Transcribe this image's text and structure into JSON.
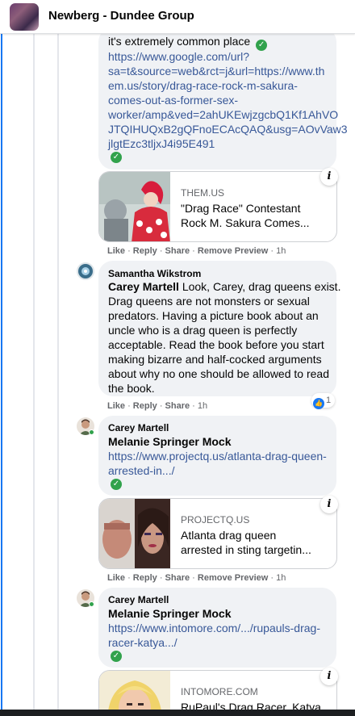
{
  "header": {
    "group_name": "Newberg - Dundee Group"
  },
  "comment1": {
    "text_tail": "it's extremely common place",
    "link_lines": [
      "https://www.google.com/url?",
      "sa=t&source=web&rct=j&url=https://www.th",
      "em.us/story/drag-race-rock-m-sakura-",
      "comes-out-as-former-sex-",
      "worker/amp&ved=2ahUKEwjzgcbQ1Kf1AhVO",
      "JTQIHUQxB2gQFnoECAcQAQ&usg=AOvVaw3",
      "jlgtEzc3tljxJ4i95E491"
    ],
    "card": {
      "domain": "THEM.US",
      "title_lines": [
        "\"Drag Race\" Contestant",
        "Rock M. Sakura Comes..."
      ]
    },
    "actions": {
      "like": "Like",
      "reply": "Reply",
      "share": "Share",
      "remove": "Remove Preview",
      "time": "1h"
    }
  },
  "comment2": {
    "author": "Samantha Wikstrom",
    "mention": "Carey Martell",
    "text_lines": [
      " Look, Carey, drag queens exist.",
      "Drag queens are not monsters or sexual",
      "predators. Having a picture book about an",
      "uncle who is a drag queen is perfectly",
      "acceptable. Read the book before you start",
      "making bizarre and half-cocked arguments",
      "about why no one should be allowed to read",
      "the book."
    ],
    "reaction_count": "1",
    "actions": {
      "like": "Like",
      "reply": "Reply",
      "share": "Share",
      "time": "1h"
    }
  },
  "comment3": {
    "author": "Carey Martell",
    "mention": "Melanie Springer Mock",
    "link_lines": [
      "https://www.projectq.us/atlanta-drag-queen-",
      "arrested-in.../"
    ],
    "card": {
      "domain": "PROJECTQ.US",
      "title_lines": [
        "Atlanta drag queen",
        "arrested in sting targetin..."
      ]
    },
    "actions": {
      "like": "Like",
      "reply": "Reply",
      "share": "Share",
      "remove": "Remove Preview",
      "time": "1h"
    }
  },
  "comment4": {
    "author": "Carey Martell",
    "mention": "Melanie Springer Mock",
    "link_lines": [
      "https://www.intomore.com/.../rupauls-drag-",
      "racer-katya.../"
    ],
    "card": {
      "domain": "INTOMORE.COM",
      "title_lines": [
        "RuPaul's Drag Racer, Katya"
      ]
    }
  },
  "colors": {
    "link": "#385898",
    "bubble": "#f0f2f5",
    "accent": "#1877f2",
    "check": "#31a24c"
  },
  "icons": {
    "verified": "check-circle-icon",
    "info": "info-icon",
    "like_reaction": "thumbs-up-icon"
  }
}
